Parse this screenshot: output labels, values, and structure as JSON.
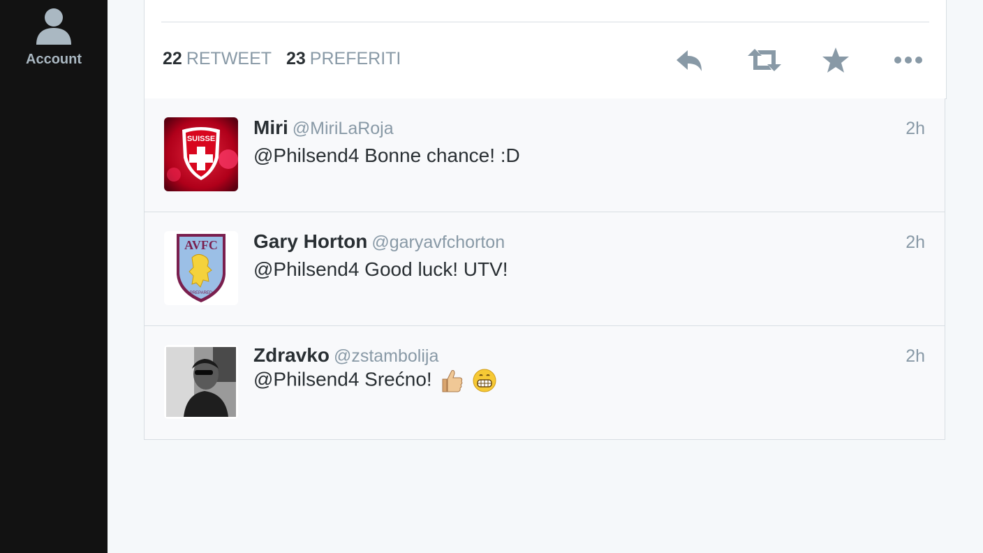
{
  "sidebar": {
    "account": {
      "label": "Account",
      "icon": "user-icon"
    }
  },
  "tweet": {
    "retweet_count": "22",
    "retweet_label": "RETWEET",
    "favorite_count": "23",
    "favorite_label": "PREFERITI",
    "actions": [
      {
        "name": "reply-button",
        "icon": "reply-icon"
      },
      {
        "name": "retweet-button",
        "icon": "retweet-icon"
      },
      {
        "name": "favorite-button",
        "icon": "star-icon"
      },
      {
        "name": "more-button",
        "icon": "more-icon"
      }
    ]
  },
  "replies": [
    {
      "name": "Miri",
      "handle": "@MiriLaRoja",
      "time": "2h",
      "text": "@Philsend4 Bonne chance! :D"
    },
    {
      "name": "Gary Horton",
      "handle": "@garyavfchorton",
      "time": "2h",
      "text": "@Philsend4 Good luck! UTV!"
    },
    {
      "name": "Zdravko",
      "handle": "@zstambolija",
      "time": "2h",
      "text": "@Philsend4 Srećno!"
    }
  ],
  "avatar_text": {
    "miri": "SUISSE",
    "gary": "AVFC",
    "gary_sub": "PREPARED"
  },
  "colors": {
    "sidebar_bg": "#121212",
    "muted_text": "#8899a6",
    "dark_text": "#292f33",
    "icon_grey": "#8899a6"
  }
}
